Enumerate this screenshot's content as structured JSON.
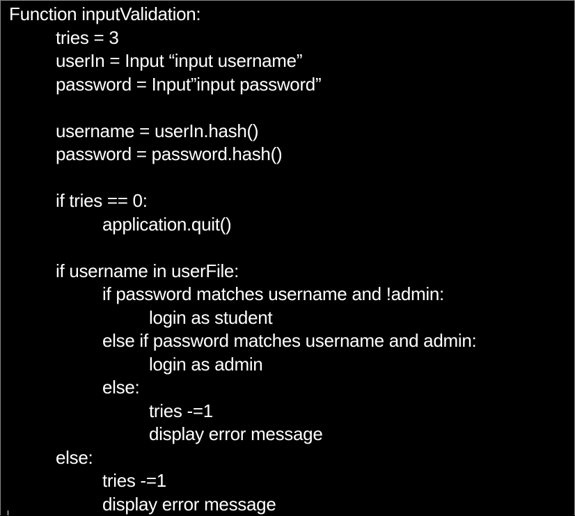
{
  "lines": [
    {
      "text": "Function inputValidation:",
      "indent": 0
    },
    {
      "text": "tries = 3",
      "indent": 1
    },
    {
      "text": "userIn = Input “input username”",
      "indent": 1
    },
    {
      "text": "password = Input”input password”",
      "indent": 1
    },
    {
      "text": "",
      "indent": 0
    },
    {
      "text": "username = userIn.hash()",
      "indent": 1
    },
    {
      "text": "password = password.hash()",
      "indent": 1
    },
    {
      "text": "",
      "indent": 0
    },
    {
      "text": "if tries == 0:",
      "indent": 1
    },
    {
      "text": "application.quit()",
      "indent": 2
    },
    {
      "text": "",
      "indent": 0
    },
    {
      "text": "if username in userFile:",
      "indent": 1
    },
    {
      "text": "if password matches username and !admin:",
      "indent": 2
    },
    {
      "text": "login as student",
      "indent": 3
    },
    {
      "text": "else if password matches username and admin:",
      "indent": 2
    },
    {
      "text": "login as admin",
      "indent": 3
    },
    {
      "text": "else:",
      "indent": 2
    },
    {
      "text": "tries -=1",
      "indent": 3
    },
    {
      "text": "display error message",
      "indent": 3
    },
    {
      "text": "else:",
      "indent": 1
    },
    {
      "text": "tries -=1",
      "indent": 2
    },
    {
      "text": "display error message",
      "indent": 2
    }
  ]
}
